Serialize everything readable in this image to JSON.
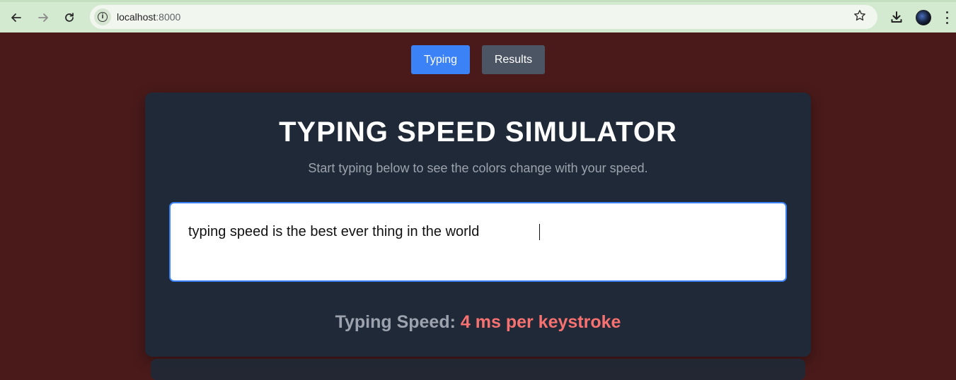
{
  "browser": {
    "url_host": "localhost",
    "url_port": ":8000"
  },
  "tabs": {
    "typing_label": "Typing",
    "results_label": "Results"
  },
  "main": {
    "title": "TYPING SPEED SIMULATOR",
    "subtitle": "Start typing below to see the colors change with your speed.",
    "input_value": "typing speed is the best ever thing in the world",
    "speed_label": "Typing Speed:",
    "speed_value": "4 ms per keystroke"
  },
  "colors": {
    "page_background": "#4a1a1a",
    "card_background": "#1f2937",
    "accent_blue": "#3b82f6",
    "results_gray": "#4b5563",
    "speed_value_color": "#f87171"
  }
}
